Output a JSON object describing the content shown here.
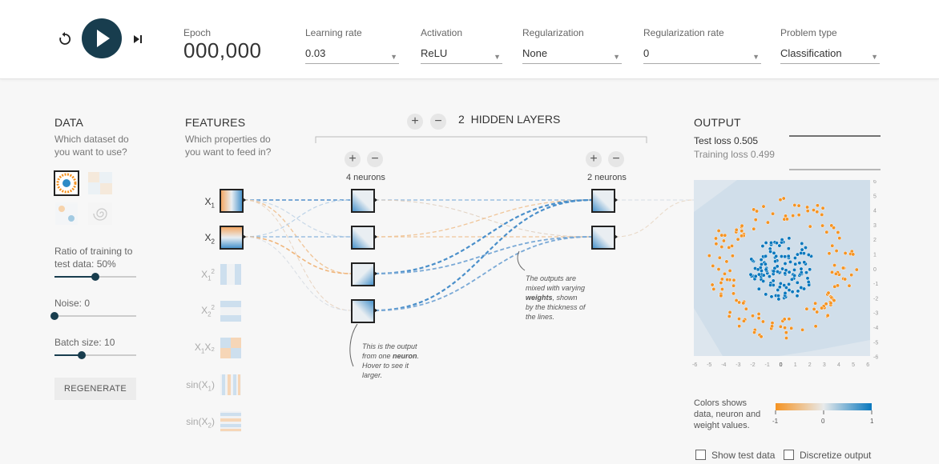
{
  "controls": {
    "reset_icon": "reset-icon",
    "play_icon": "play-icon",
    "step_icon": "step-icon"
  },
  "epoch": {
    "label": "Epoch",
    "value": "000,000"
  },
  "params": [
    {
      "label": "Learning rate",
      "value": "0.03"
    },
    {
      "label": "Activation",
      "value": "ReLU"
    },
    {
      "label": "Regularization",
      "value": "None"
    },
    {
      "label": "Regularization rate",
      "value": "0"
    },
    {
      "label": "Problem type",
      "value": "Classification"
    }
  ],
  "data_panel": {
    "title": "DATA",
    "subtitle_line1": "Which dataset do",
    "subtitle_line2": "you want to use?",
    "ratio_label_line1": "Ratio of training to",
    "ratio_label_line2": "test data:  50%",
    "ratio_value": 0.5,
    "noise_label": "Noise:  0",
    "noise_value": 0,
    "batch_label": "Batch size:  10",
    "batch_value": 0.33,
    "regenerate": "REGENERATE"
  },
  "features_panel": {
    "title": "FEATURES",
    "subtitle_line1": "Which properties do",
    "subtitle_line2": "you want to feed in?",
    "items": [
      {
        "base": "X",
        "sub": "1",
        "sup": "",
        "pre": "",
        "post": ""
      },
      {
        "base": "X",
        "sub": "2",
        "sup": "",
        "pre": "",
        "post": ""
      },
      {
        "base": "X",
        "sub": "1",
        "sup": "2",
        "pre": "",
        "post": ""
      },
      {
        "base": "X",
        "sub": "2",
        "sup": "2",
        "pre": "",
        "post": ""
      },
      {
        "base": "X",
        "sub": "1",
        "sup": "",
        "pre": "",
        "post": "X₂"
      },
      {
        "base": "X",
        "sub": "1",
        "sup": "",
        "pre": "sin(",
        "post": ")"
      },
      {
        "base": "X",
        "sub": "2",
        "sup": "",
        "pre": "sin(",
        "post": ")"
      }
    ]
  },
  "network": {
    "hidden_layers_label": "HIDDEN LAYERS",
    "hidden_layers_count": "2",
    "plus": "+",
    "minus": "−",
    "layer1_neurons": "4 neurons",
    "layer2_neurons": "2 neurons",
    "annotation_neuron": [
      "This is the output",
      "from one neuron.",
      "Hover to see it",
      "larger."
    ],
    "annotation_neuron_bold": "neuron",
    "annotation_weights": [
      "The outputs are",
      "mixed with varying",
      "weights, shown",
      "by the thickness of",
      "the lines."
    ],
    "annotation_weights_bold": "weights"
  },
  "output_panel": {
    "title": "OUTPUT",
    "test_loss": "Test loss 0.505",
    "training_loss": "Training loss 0.499",
    "y_ticks": [
      "6",
      "5",
      "4",
      "3",
      "2",
      "1",
      "0",
      "-1",
      "-2",
      "-3",
      "-4",
      "-5",
      "-6"
    ],
    "x_ticks": [
      "-6",
      "-5",
      "-4",
      "-3",
      "-2",
      "-1",
      "0",
      "1",
      "2",
      "3",
      "4",
      "5",
      "6"
    ],
    "legend_text_line1": "Colors shows",
    "legend_text_line2": "data, neuron and",
    "legend_text_line3": "weight values.",
    "legend_ticks": [
      "-1",
      "0",
      "1"
    ],
    "show_test_data": "Show test data",
    "discretize_output": "Discretize output"
  },
  "colors": {
    "orange": "#f59322",
    "blue": "#0877bd",
    "dark": "#183d4e"
  }
}
